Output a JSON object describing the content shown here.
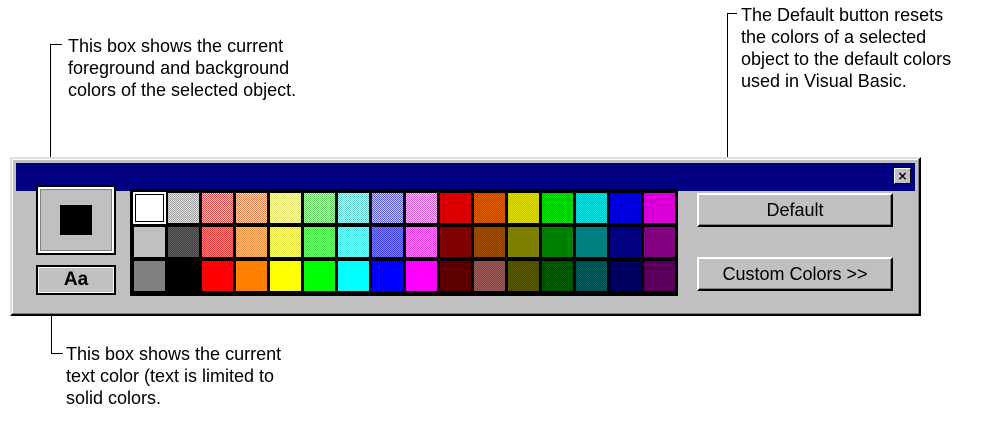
{
  "callouts": {
    "top_left": "This box shows the current\nforeground and background\ncolors of the selected object.",
    "top_right": "The Default button resets\nthe colors of a selected\nobject to the default colors\nused in Visual Basic.",
    "bottom_left": "This box shows the current\ntext color (text is limited to\nsolid colors."
  },
  "window": {
    "close_glyph": "×",
    "sample_text": "Aa",
    "buttons": {
      "default": "Default",
      "custom": "Custom Colors >>"
    }
  },
  "palette": {
    "rows": [
      [
        {
          "color": "#ffffff",
          "dither": false,
          "selected": true
        },
        {
          "color": "#e0e0e0",
          "alt": "#a0a0a0",
          "dither": true
        },
        {
          "color": "#ffc0c0",
          "alt": "#e05050",
          "dither": true
        },
        {
          "color": "#ffe0c0",
          "alt": "#e08050",
          "dither": true
        },
        {
          "color": "#ffffc0",
          "alt": "#e0e070",
          "dither": true
        },
        {
          "color": "#c0ffc0",
          "alt": "#60d060",
          "dither": true
        },
        {
          "color": "#c0ffff",
          "alt": "#60d0d0",
          "dither": true
        },
        {
          "color": "#c0c0ff",
          "alt": "#6060d0",
          "dither": true
        },
        {
          "color": "#ffc0ff",
          "alt": "#d060d0",
          "dither": true
        },
        {
          "color": "#c00000",
          "alt": "#e00000",
          "dither": true
        },
        {
          "color": "#c04000",
          "alt": "#e06000",
          "dither": true
        },
        {
          "color": "#c0c000",
          "alt": "#e0e000",
          "dither": true
        },
        {
          "color": "#00c000",
          "alt": "#00e000",
          "dither": true
        },
        {
          "color": "#00c0c0",
          "alt": "#00e0e0",
          "dither": true
        },
        {
          "color": "#0000c0",
          "alt": "#0000e0",
          "dither": true
        },
        {
          "color": "#c000c0",
          "alt": "#e000e0",
          "dither": true
        }
      ],
      [
        {
          "color": "#c0c0c0",
          "dither": false
        },
        {
          "color": "#404040",
          "alt": "#606060",
          "dither": true
        },
        {
          "color": "#ff8080",
          "alt": "#e04040",
          "dither": true
        },
        {
          "color": "#ffc080",
          "alt": "#e09040",
          "dither": true
        },
        {
          "color": "#ffff80",
          "alt": "#e0e040",
          "dither": true
        },
        {
          "color": "#80ff80",
          "alt": "#40e040",
          "dither": true
        },
        {
          "color": "#80ffff",
          "alt": "#40e0e0",
          "dither": true
        },
        {
          "color": "#8080ff",
          "alt": "#4040e0",
          "dither": true
        },
        {
          "color": "#ff80ff",
          "alt": "#e040e0",
          "dither": true
        },
        {
          "color": "#800000",
          "dither": false
        },
        {
          "color": "#804000",
          "alt": "#a05000",
          "dither": true
        },
        {
          "color": "#808000",
          "dither": false
        },
        {
          "color": "#008000",
          "dither": false
        },
        {
          "color": "#008080",
          "dither": false
        },
        {
          "color": "#000080",
          "dither": false
        },
        {
          "color": "#800080",
          "dither": false
        }
      ],
      [
        {
          "color": "#808080",
          "dither": false
        },
        {
          "color": "#000000",
          "dither": false
        },
        {
          "color": "#ff0000",
          "dither": false
        },
        {
          "color": "#ff8000",
          "dither": false
        },
        {
          "color": "#ffff00",
          "dither": false
        },
        {
          "color": "#00ff00",
          "dither": false
        },
        {
          "color": "#00ffff",
          "dither": false
        },
        {
          "color": "#0000ff",
          "dither": false
        },
        {
          "color": "#ff00ff",
          "dither": false
        },
        {
          "color": "#400000",
          "alt": "#600000",
          "dither": true
        },
        {
          "color": "#804040",
          "alt": "#a06060",
          "dither": true
        },
        {
          "color": "#404000",
          "alt": "#606000",
          "dither": true
        },
        {
          "color": "#004000",
          "alt": "#006000",
          "dither": true
        },
        {
          "color": "#004040",
          "alt": "#006060",
          "dither": true
        },
        {
          "color": "#000040",
          "alt": "#000060",
          "dither": true
        },
        {
          "color": "#400040",
          "alt": "#600060",
          "dither": true
        }
      ]
    ]
  },
  "colors": {
    "titlebar": "#000080",
    "face": "#c0c0c0",
    "foreground_swatch": "#000000"
  }
}
